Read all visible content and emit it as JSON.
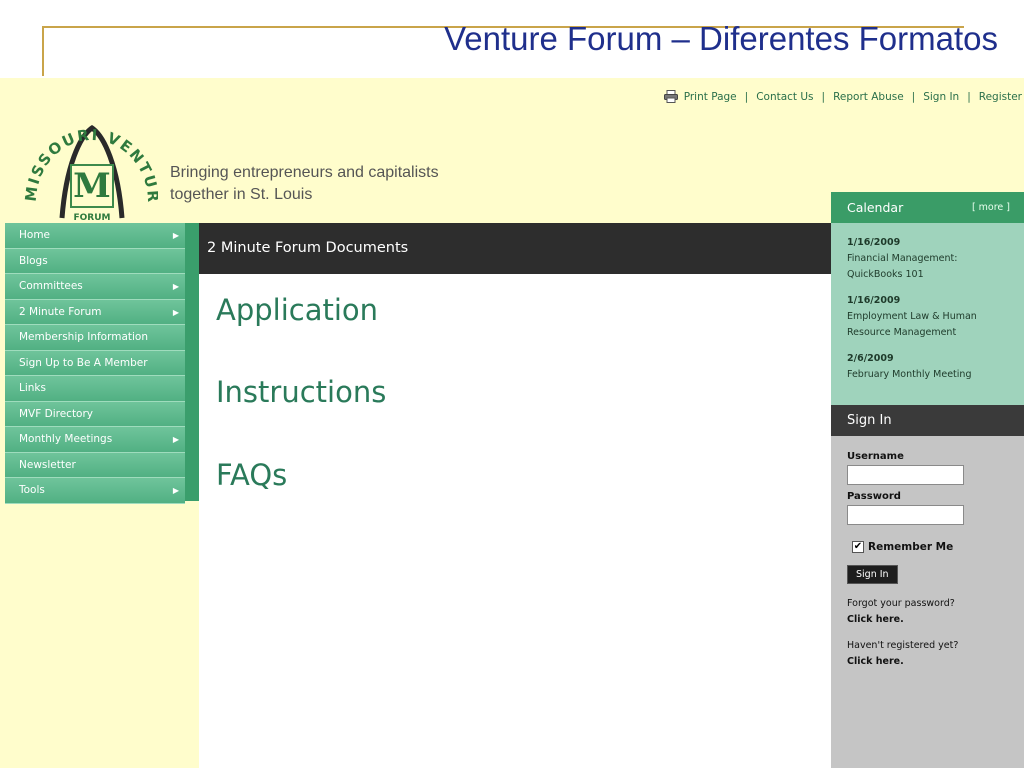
{
  "slide": {
    "title": "Venture Forum – Diferentes Formatos",
    "frame_color": "#c9a44a",
    "title_color": "#1f2f8c"
  },
  "site": {
    "top_links": {
      "print_icon": "printer-icon",
      "print": "Print Page",
      "contact": "Contact Us",
      "report": "Report Abuse",
      "signin": "Sign In",
      "register": "Register",
      "separator": "|"
    },
    "logo": {
      "arc_text": "MISSOURI VENTURE",
      "letter": "M",
      "forum": "FORUM"
    },
    "tagline": {
      "line1": "Bringing entrepreneurs and capitalists",
      "line2": "together in St. Louis"
    },
    "nav": [
      {
        "label": "Home",
        "has_arrow": true
      },
      {
        "label": "Blogs",
        "has_arrow": false
      },
      {
        "label": "Committees",
        "has_arrow": true
      },
      {
        "label": "2 Minute Forum",
        "has_arrow": true
      },
      {
        "label": "Membership Information",
        "has_arrow": false
      },
      {
        "label": "Sign Up to Be A Member",
        "has_arrow": false
      },
      {
        "label": "Links",
        "has_arrow": false
      },
      {
        "label": "MVF Directory",
        "has_arrow": false
      },
      {
        "label": "Monthly Meetings",
        "has_arrow": true
      },
      {
        "label": "Newsletter",
        "has_arrow": false
      },
      {
        "label": "Tools",
        "has_arrow": true
      }
    ],
    "nav_arrow": "▶",
    "main": {
      "header": "2 Minute Forum Documents",
      "links": [
        "Application",
        "Instructions",
        "FAQs"
      ]
    },
    "calendar": {
      "title": "Calendar",
      "more": "[ more ]",
      "events": [
        {
          "date": "1/16/2009",
          "line1": "Financial Management:",
          "line2": "QuickBooks 101"
        },
        {
          "date": "1/16/2009",
          "line1": "Employment Law & Human",
          "line2": "Resource Management"
        },
        {
          "date": "2/6/2009",
          "line1": "February Monthly Meeting",
          "line2": ""
        }
      ]
    },
    "signin": {
      "title": "Sign In",
      "username_label": "Username",
      "username_value": "",
      "password_label": "Password",
      "password_value": "",
      "remember_label": "Remember Me",
      "remember_checked": true,
      "check_mark": "✔",
      "button": "Sign In",
      "forgot_q": "Forgot your password?",
      "forgot_link": "Click here.",
      "register_q": "Haven't registered yet?",
      "register_link": "Click here."
    },
    "colors": {
      "background": "#fffdcc",
      "nav_green": "#51b083",
      "header_dark": "#2d2d2d",
      "calendar_green": "#3a9c67",
      "calendar_body": "#9fd3bc",
      "link_green": "#2a7a5a"
    }
  }
}
